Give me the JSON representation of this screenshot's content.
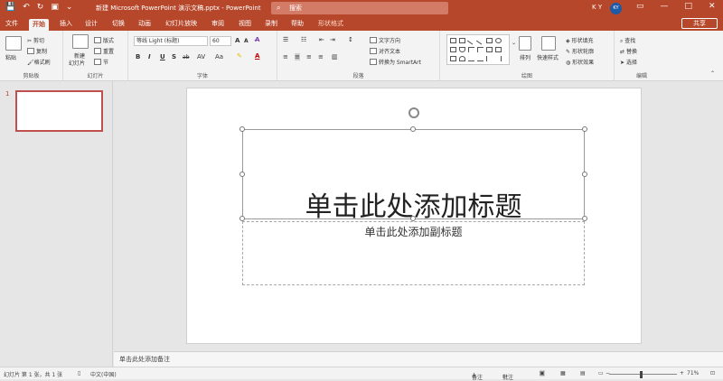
{
  "app": {
    "doc_title": "新建 Microsoft PowerPoint 演示文稿.pptx  -  PowerPoint",
    "search_placeholder": "搜索",
    "user_initials": "K Y",
    "avatar": "KY",
    "share": "共享"
  },
  "tabs": [
    {
      "label": "文件"
    },
    {
      "label": "开始"
    },
    {
      "label": "插入"
    },
    {
      "label": "设计"
    },
    {
      "label": "切换"
    },
    {
      "label": "动画"
    },
    {
      "label": "幻灯片放映"
    },
    {
      "label": "审阅"
    },
    {
      "label": "视图"
    },
    {
      "label": "录制"
    },
    {
      "label": "帮助"
    },
    {
      "label": "形状格式"
    }
  ],
  "ribbon": {
    "clipboard": {
      "label": "剪贴板",
      "paste": "粘贴",
      "cut": "剪切",
      "copy": "复制",
      "format_painter": "格式刷"
    },
    "slides": {
      "label": "幻灯片",
      "new_slide": "新建",
      "new_slide2": "幻灯片",
      "layout": "版式",
      "reset": "重置",
      "section": "节"
    },
    "font": {
      "label": "字体",
      "font_name": "等线 Light (标题)",
      "font_size": "60",
      "bold": "B",
      "italic": "I",
      "underline": "U",
      "strike": "S",
      "spacing": "ab",
      "case": "Aa",
      "grow": "A",
      "shrink": "A"
    },
    "paragraph": {
      "label": "段落",
      "text_direction": "文字方向",
      "align_text": "对齐文本",
      "smartart": "转换为 SmartArt"
    },
    "drawing": {
      "label": "绘图",
      "arrange": "排列",
      "quick_styles": "快速样式",
      "shape_fill": "形状填充",
      "shape_outline": "形状轮廓",
      "shape_effects": "形状效果"
    },
    "editing": {
      "label": "编辑",
      "find": "查找",
      "replace": "替换",
      "select": "选择"
    }
  },
  "thumbs": {
    "number": "1"
  },
  "slide": {
    "title_placeholder": "单击此处添加标题",
    "subtitle_placeholder": "单击此处添加副标题"
  },
  "notes_placeholder": "单击此处添加备注",
  "status": {
    "slide_info": "幻灯片 第 1 张，共 1 张",
    "language": "中文(中国)",
    "notes": "备注",
    "comments": "批注",
    "zoom": "71%"
  }
}
